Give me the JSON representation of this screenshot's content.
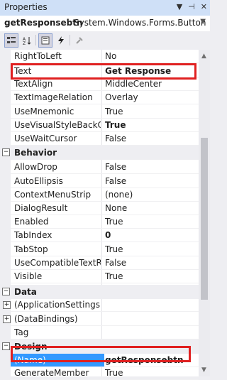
{
  "window": {
    "title": "Properties"
  },
  "object_selector": {
    "name": "getResponsebtn",
    "type": "System.Windows.Forms.Button"
  },
  "toolbar": {
    "icons": [
      "categorized-icon",
      "alphabetical-icon",
      "properties-icon",
      "events-icon",
      "property-pages-icon"
    ]
  },
  "rows": [
    {
      "kind": "prop",
      "name": "RightToLeft",
      "value": "No",
      "bold": false
    },
    {
      "kind": "prop",
      "name": "Text",
      "value": "Get Response",
      "bold": true,
      "highlight": true
    },
    {
      "kind": "prop",
      "name": "TextAlign",
      "value": "MiddleCenter",
      "bold": false
    },
    {
      "kind": "prop",
      "name": "TextImageRelation",
      "value": "Overlay",
      "bold": false
    },
    {
      "kind": "prop",
      "name": "UseMnemonic",
      "value": "True",
      "bold": false
    },
    {
      "kind": "prop",
      "name": "UseVisualStyleBackColor",
      "value": "True",
      "bold": true
    },
    {
      "kind": "prop",
      "name": "UseWaitCursor",
      "value": "False",
      "bold": false
    },
    {
      "kind": "cat",
      "name": "Behavior"
    },
    {
      "kind": "prop",
      "name": "AllowDrop",
      "value": "False",
      "bold": false
    },
    {
      "kind": "prop",
      "name": "AutoEllipsis",
      "value": "False",
      "bold": false
    },
    {
      "kind": "prop",
      "name": "ContextMenuStrip",
      "value": "(none)",
      "bold": false
    },
    {
      "kind": "prop",
      "name": "DialogResult",
      "value": "None",
      "bold": false
    },
    {
      "kind": "prop",
      "name": "Enabled",
      "value": "True",
      "bold": false
    },
    {
      "kind": "prop",
      "name": "TabIndex",
      "value": "0",
      "bold": true
    },
    {
      "kind": "prop",
      "name": "TabStop",
      "value": "True",
      "bold": false
    },
    {
      "kind": "prop",
      "name": "UseCompatibleTextRendering",
      "value": "False",
      "bold": false
    },
    {
      "kind": "prop",
      "name": "Visible",
      "value": "True",
      "bold": false
    },
    {
      "kind": "cat",
      "name": "Data"
    },
    {
      "kind": "prop",
      "name": "(ApplicationSettings)",
      "value": "",
      "bold": false,
      "expandable": true
    },
    {
      "kind": "prop",
      "name": "(DataBindings)",
      "value": "",
      "bold": false,
      "expandable": true
    },
    {
      "kind": "prop",
      "name": "Tag",
      "value": "",
      "bold": false
    },
    {
      "kind": "cat",
      "name": "Design"
    },
    {
      "kind": "prop",
      "name": "(Name)",
      "value": "getResponsebtn",
      "bold": true,
      "selected": true,
      "highlight": true
    },
    {
      "kind": "prop",
      "name": "GenerateMember",
      "value": "True",
      "bold": false
    }
  ]
}
